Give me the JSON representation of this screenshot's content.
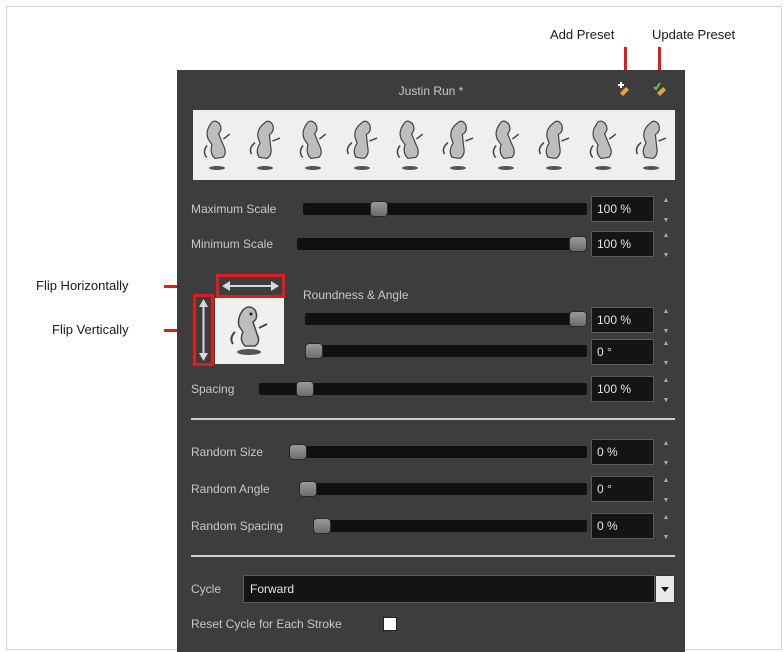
{
  "annotations": {
    "add_preset": "Add Preset",
    "update_preset": "Update Preset",
    "flip_horizontally": "Flip Horizontally",
    "flip_vertically": "Flip Vertically"
  },
  "panel": {
    "title": "Justin Run *",
    "strip_frames": 10,
    "sliders": {
      "maximum_scale": {
        "label": "Maximum Scale",
        "value": "100 %",
        "level": 0.25
      },
      "minimum_scale": {
        "label": "Minimum Scale",
        "value": "100 %",
        "level": 1.0
      },
      "roundness_label": "Roundness & Angle",
      "roundness": {
        "value": "100 %",
        "level": 1.0
      },
      "angle": {
        "value": "0 °",
        "level": 0.0
      },
      "spacing": {
        "label": "Spacing",
        "value": "100 %",
        "level": 0.12
      },
      "random_size": {
        "label": "Random Size",
        "value": "0 %",
        "level": 0.0
      },
      "random_angle": {
        "label": "Random Angle",
        "value": "0 °",
        "level": 0.0
      },
      "random_spacing": {
        "label": "Random Spacing",
        "value": "0 %",
        "level": 0.0
      }
    },
    "cycle": {
      "label": "Cycle",
      "value": "Forward"
    },
    "reset_cycle": {
      "label": "Reset Cycle for Each Stroke",
      "checked": false
    }
  },
  "colors": {
    "panel_bg": "#3d3d3d",
    "annotation_red": "#e21b1b"
  }
}
